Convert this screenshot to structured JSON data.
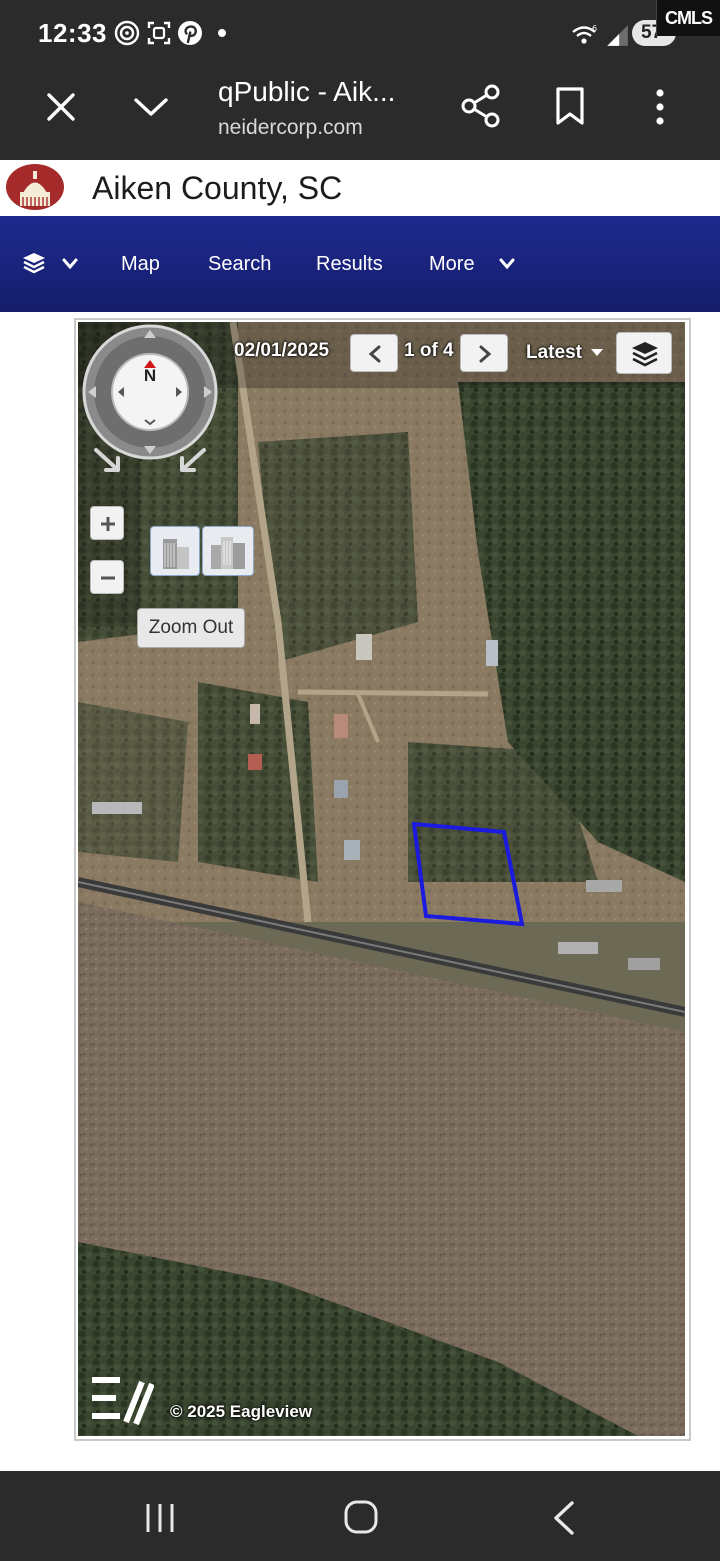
{
  "status_bar": {
    "time": "12:33",
    "icons": [
      "location-ring-icon",
      "screenshot-icon",
      "pinterest-icon",
      "dot-icon",
      "wifi-6-icon",
      "signal-icon"
    ],
    "battery": "57",
    "watermark": "CMLS"
  },
  "browser": {
    "title": "qPublic - Aik...",
    "url": "neidercorp.com",
    "icons": [
      "close-icon",
      "chevron-down-icon",
      "share-icon",
      "bookmark-icon",
      "more-vert-icon"
    ]
  },
  "site": {
    "county": "Aiken County, SC"
  },
  "nav": {
    "layers_icon": "layers-icon",
    "items": [
      "Map",
      "Search",
      "Results",
      "More"
    ]
  },
  "map": {
    "date": "02/01/2025",
    "page": "1 of 4",
    "version": "Latest",
    "compass_label": "N",
    "tooltip": "Zoom Out",
    "copyright": "© 2025 Eagleview",
    "colors": {
      "parcel_outline": "#1b1be0",
      "nav_bar": "#1a2380"
    }
  },
  "system_nav": {
    "icons": [
      "recents-icon",
      "home-icon",
      "back-icon"
    ]
  }
}
